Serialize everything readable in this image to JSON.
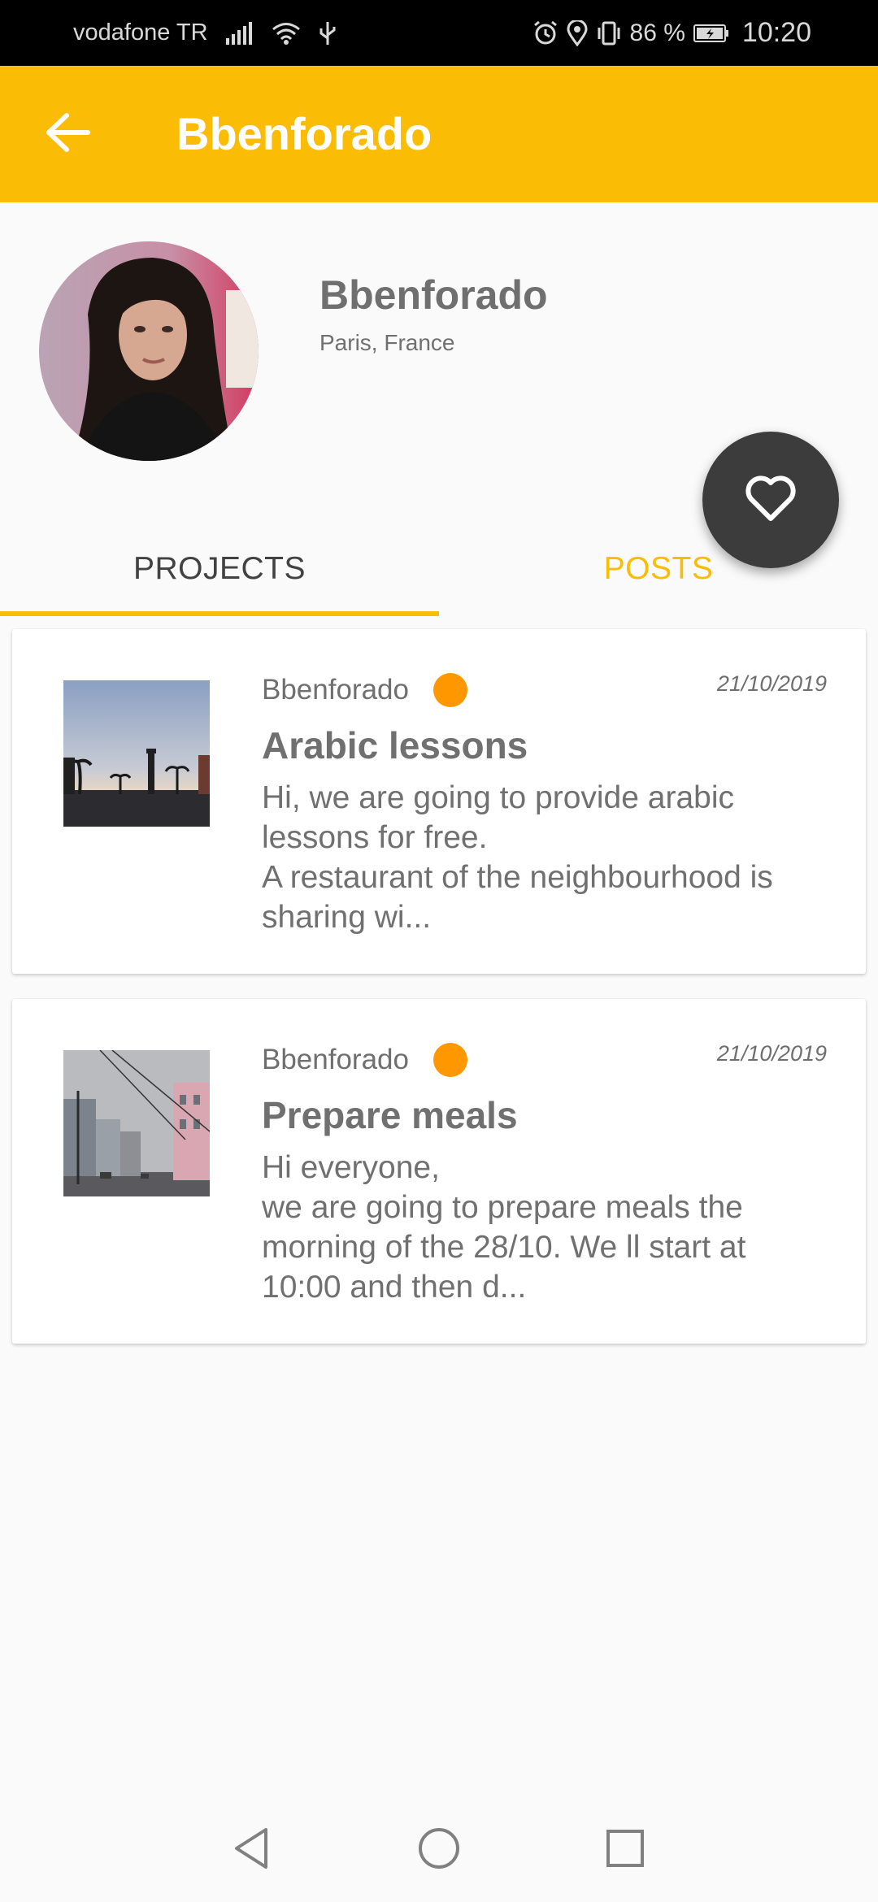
{
  "status_bar": {
    "carrier": "vodafone TR",
    "battery_percent": "86 %",
    "time": "10:20",
    "icons": [
      "signal-icon",
      "wifi-icon",
      "usb-icon",
      "alarm-icon",
      "location-icon",
      "vibrate-icon",
      "battery-icon"
    ]
  },
  "app_bar": {
    "title": "Bbenforado",
    "back_icon": "arrow-back-icon",
    "color": "#fbbc05"
  },
  "profile": {
    "name": "Bbenforado",
    "location": "Paris, France"
  },
  "fab": {
    "icon": "heart-outline-icon",
    "color": "#3c3c3c"
  },
  "tabs": [
    {
      "label": "PROJECTS",
      "selected": true
    },
    {
      "label": "POSTS",
      "selected": false
    }
  ],
  "cards": [
    {
      "author": "Bbenforado",
      "date": "21/10/2019",
      "title": "Arabic lessons",
      "body": "Hi, we are going to provide arabic\nlessons for free.\nA restaurant of the neighbourhood is\nsharing wi...",
      "status_color": "#ff9800"
    },
    {
      "author": "Bbenforado",
      "date": "21/10/2019",
      "title": "Prepare meals",
      "body": "Hi everyone,\nwe are going to prepare meals the\nmorning of the 28/10. We ll start at\n10:00 and then d...",
      "status_color": "#ff9800"
    }
  ],
  "nav_bar": {
    "icons": [
      "nav-back-icon",
      "nav-home-icon",
      "nav-recents-icon"
    ]
  }
}
